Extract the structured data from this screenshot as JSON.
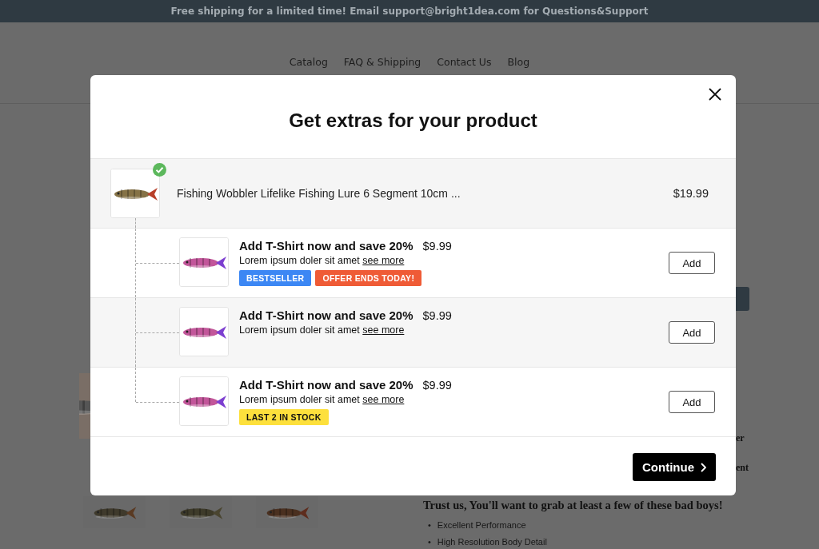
{
  "announcement": "Free shipping for a limited time! Email support@bright1dea.com for Questions&Support",
  "nav": [
    "Catalog",
    "FAQ & Shipping",
    "Contact Us",
    "Blog"
  ],
  "background": {
    "side_fragments": [
      "er",
      "ent"
    ],
    "gallery": [
      {
        "kind": "picture"
      },
      {
        "kind": "picture"
      },
      {
        "kind": "picture"
      }
    ],
    "heading": "Trust us, You'll want to grab at least a few of these bad boys!",
    "bullets": [
      {
        "marker": "•",
        "text": "Excellent Performance"
      },
      {
        "marker": "•",
        "text": "High Resolution Body Detail"
      }
    ]
  },
  "modal": {
    "title": "Get extras for your product",
    "main_product": {
      "name": "Fishing Wobbler Lifelike Fishing Lure 6 Segment 10cm ...",
      "price": "$19.99",
      "added": true
    },
    "addons": [
      {
        "title": "Add T-Shirt now and save 20%",
        "price": "$9.99",
        "description": "Lorem ipsum doler sit amet",
        "link": "see more",
        "button": "Add",
        "badges": [
          {
            "label": "BESTSELLER",
            "color": "#3c87f4"
          },
          {
            "label": "OFFER ENDS TODAY!",
            "color": "#ef5b36"
          }
        ]
      },
      {
        "title": "Add T-Shirt now and save 20%",
        "price": "$9.99",
        "description": "Lorem ipsum doler sit amet",
        "link": "see more",
        "button": "Add"
      },
      {
        "title": "Add T-Shirt now and save 20%",
        "price": "$9.99",
        "description": "Lorem ipsum doler sit amet",
        "link": "see more",
        "button": "Add",
        "badges": [
          {
            "label": "LAST 2 IN STOCK",
            "color": "#fde03c"
          }
        ]
      }
    ],
    "continue_button": "Continue"
  }
}
